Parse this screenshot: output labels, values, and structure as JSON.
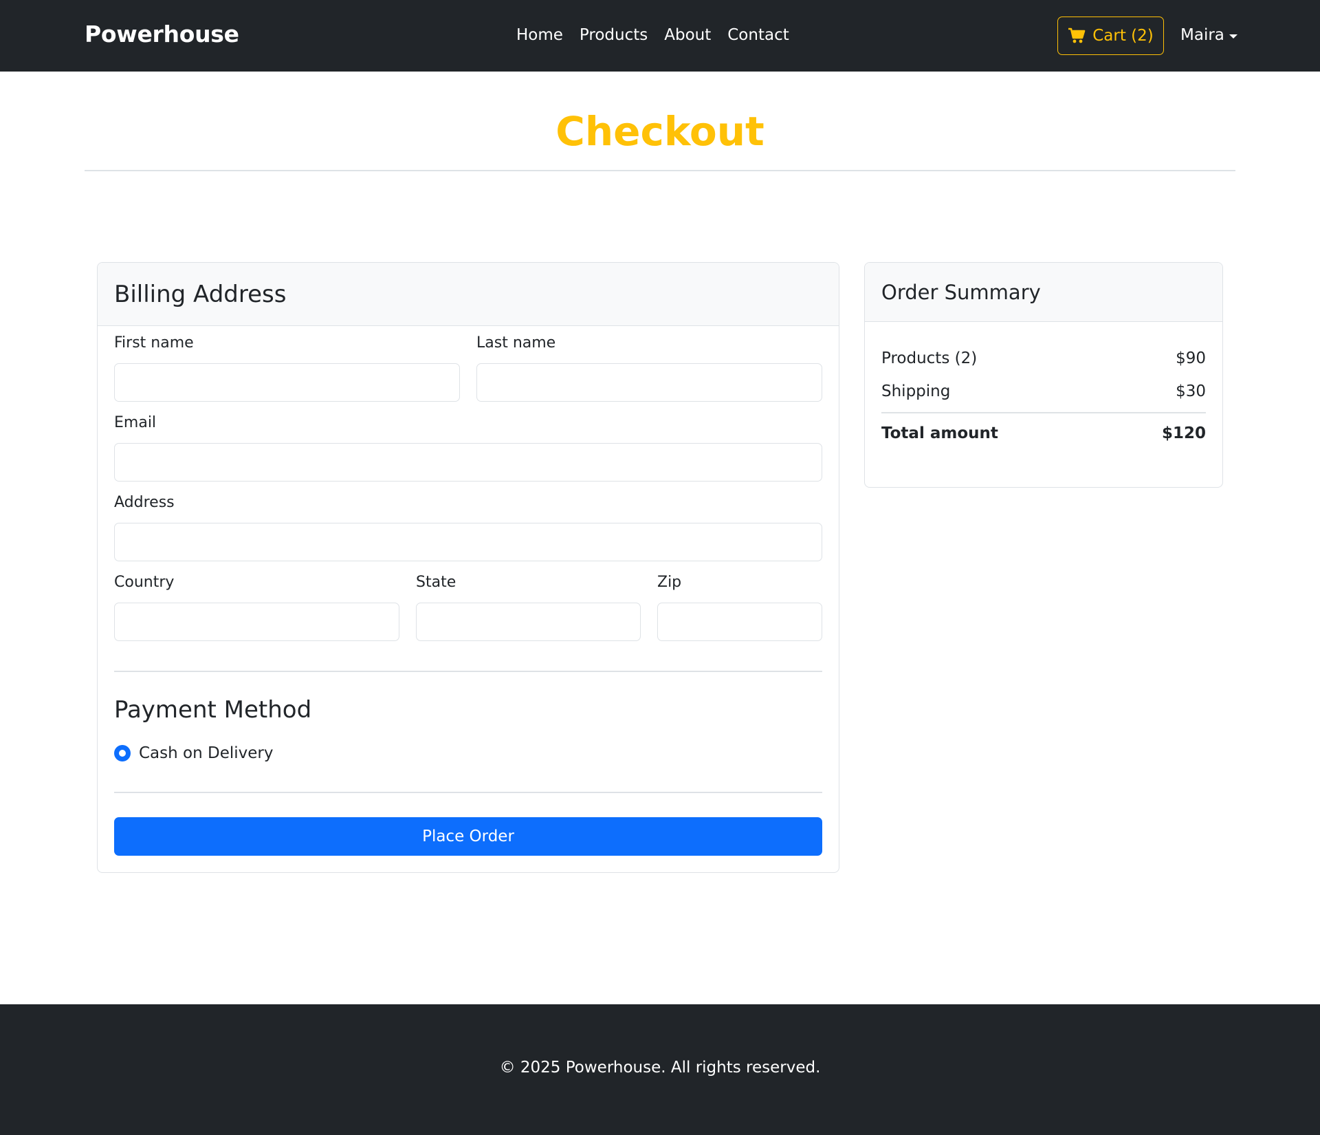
{
  "navbar": {
    "brand": "Powerhouse",
    "links": [
      "Home",
      "Products",
      "About",
      "Contact"
    ],
    "cart_label": "Cart (2)",
    "user_name": "Maira"
  },
  "page": {
    "title": "Checkout"
  },
  "billing": {
    "title": "Billing Address",
    "fields": {
      "first_name": {
        "label": "First name",
        "value": ""
      },
      "last_name": {
        "label": "Last name",
        "value": ""
      },
      "email": {
        "label": "Email",
        "value": ""
      },
      "address": {
        "label": "Address",
        "value": ""
      },
      "country": {
        "label": "Country",
        "value": ""
      },
      "state": {
        "label": "State",
        "value": ""
      },
      "zip": {
        "label": "Zip",
        "value": ""
      }
    },
    "payment_title": "Payment Method",
    "payment_option": "Cash on Delivery",
    "place_order_label": "Place Order"
  },
  "summary": {
    "title": "Order Summary",
    "rows": [
      {
        "label": "Products (2)",
        "value": "$90"
      },
      {
        "label": "Shipping",
        "value": "$30"
      }
    ],
    "total_label": "Total amount",
    "total_value": "$120"
  },
  "footer": {
    "text": "© 2025 Powerhouse. All rights reserved."
  },
  "colors": {
    "navbar_bg": "#212529",
    "accent": "#ffc107",
    "primary": "#0d6efd",
    "border": "#dee2e6"
  },
  "icons": {
    "cart": "shopping-cart-icon",
    "user_dropdown": "caret-down-icon",
    "payment_radio": "radio-selected"
  }
}
